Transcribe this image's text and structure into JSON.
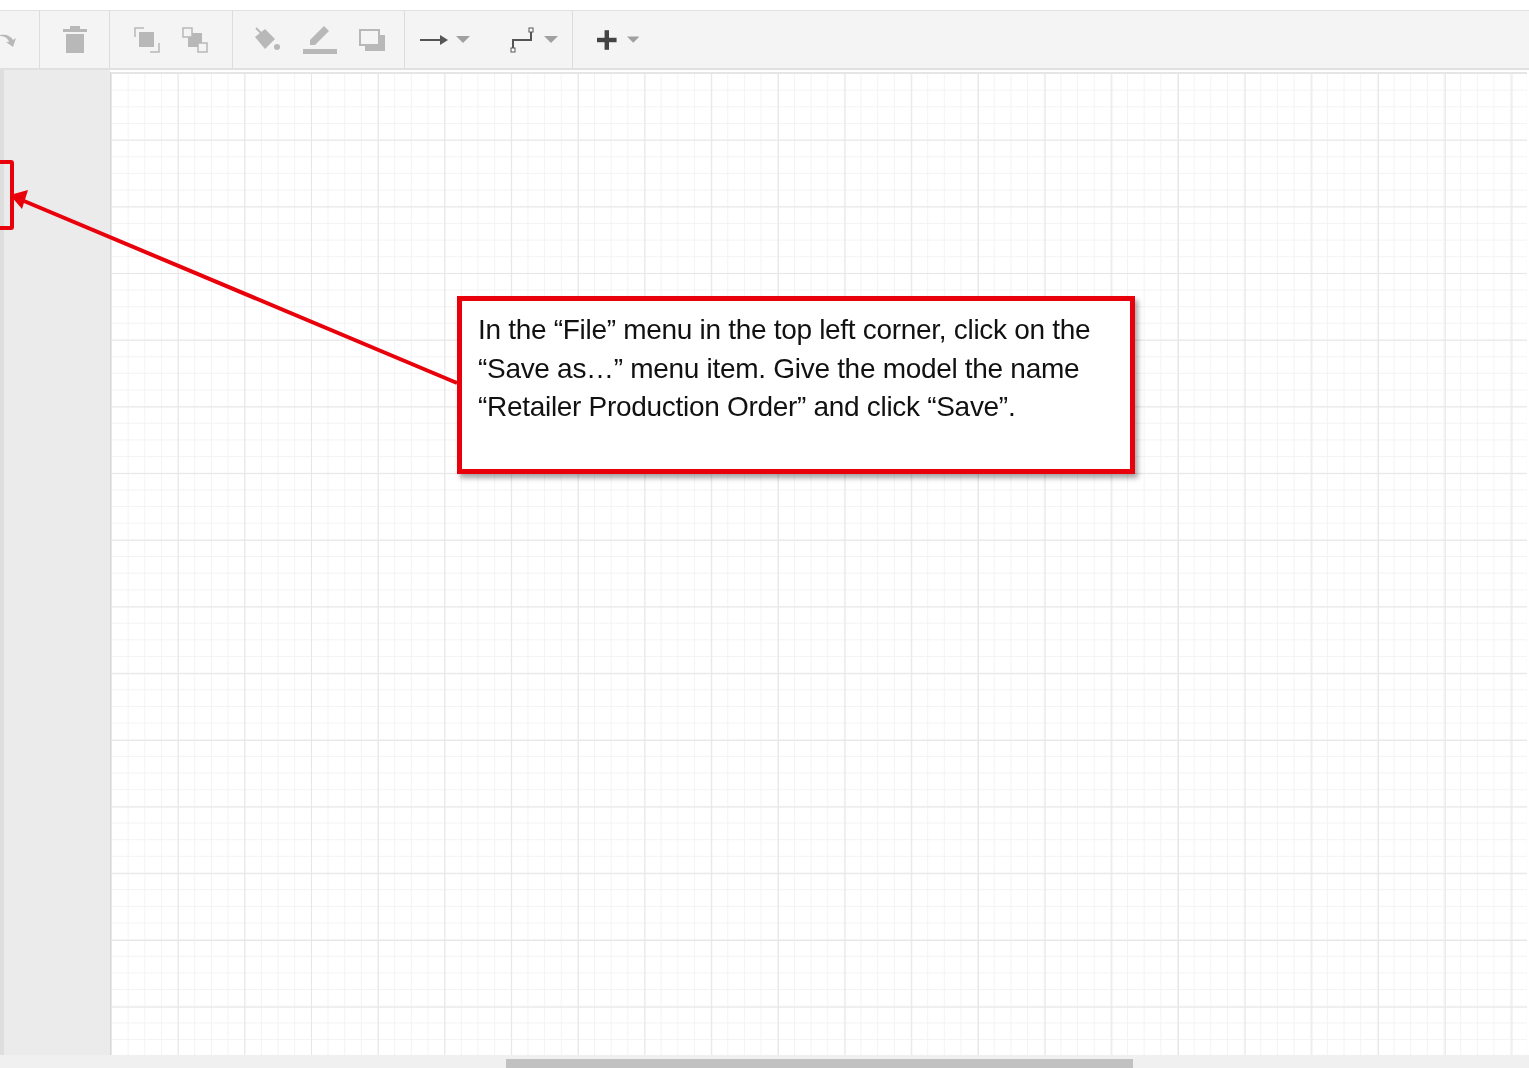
{
  "callout": {
    "text": "In the “File” menu in the top left corner, click on the “Save as…” menu item. Give the model the name “Retailer Production Order” and click “Save”."
  }
}
